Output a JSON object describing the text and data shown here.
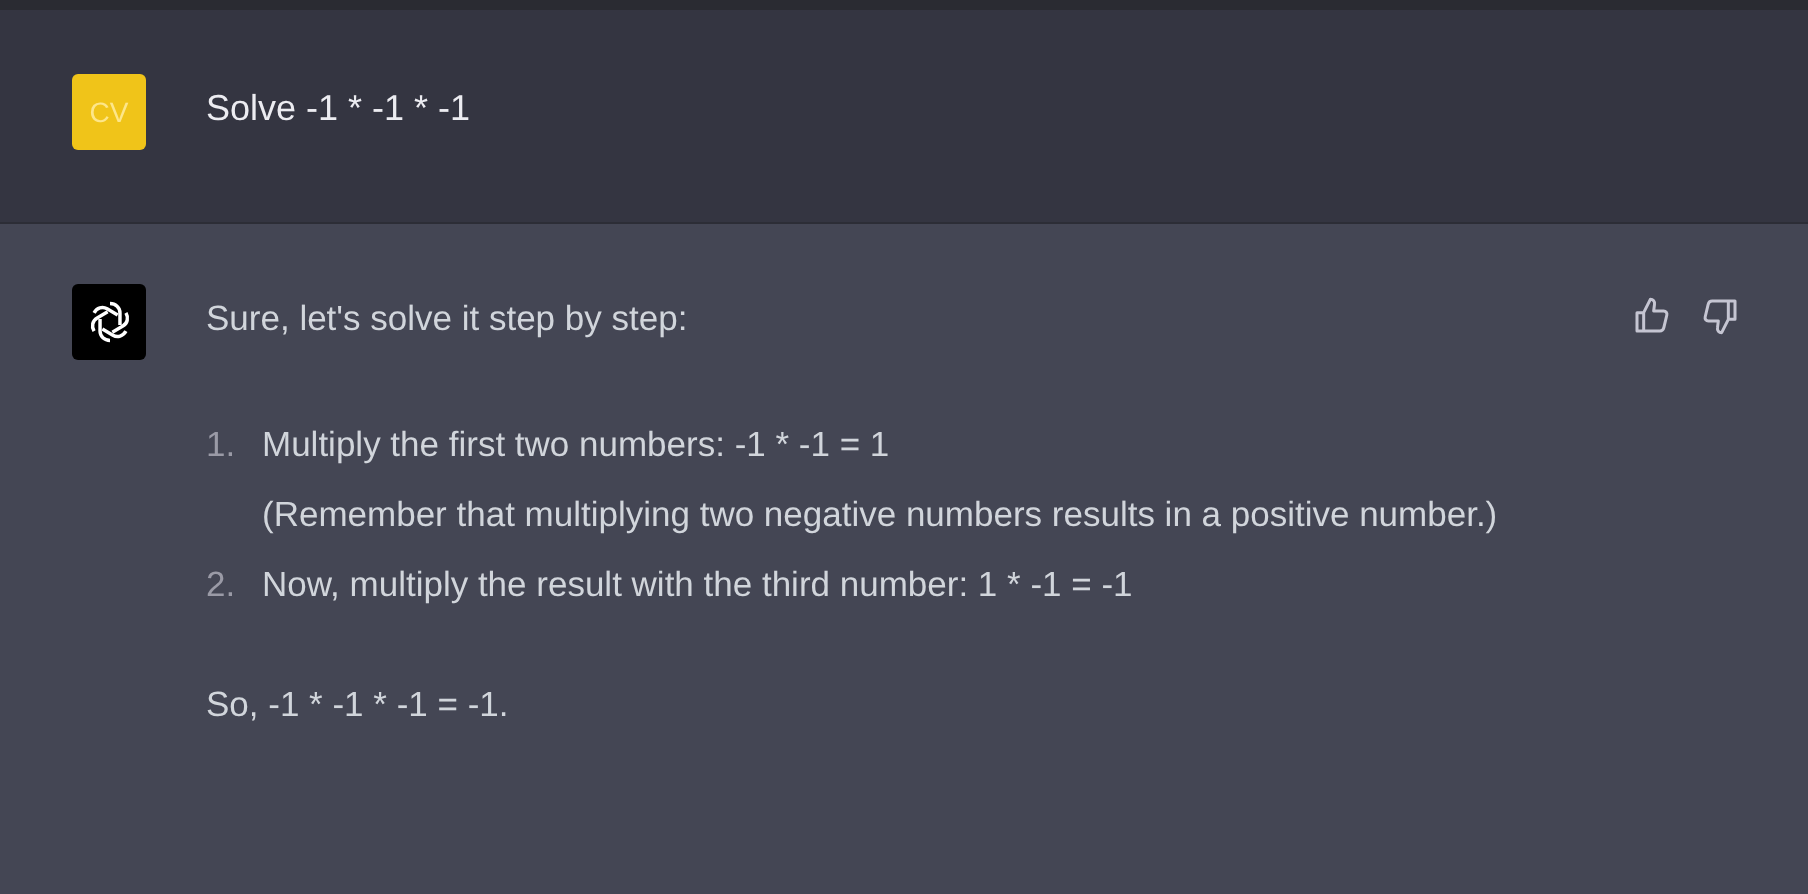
{
  "messages": [
    {
      "kind": "user",
      "avatar": "CV",
      "text": "Solve -1 * -1 * -1"
    },
    {
      "kind": "assistant",
      "intro": "Sure, let's solve it step by step:",
      "steps": [
        {
          "number": "1.",
          "text": "Multiply the first two numbers: -1 * -1 = 1",
          "note": "(Remember that multiplying two negative numbers results in a positive number.)"
        },
        {
          "number": "2.",
          "text": "Now, multiply the result with the third number: 1 * -1 = -1"
        }
      ],
      "conclusion": "So, -1 * -1 * -1 = -1."
    }
  ]
}
